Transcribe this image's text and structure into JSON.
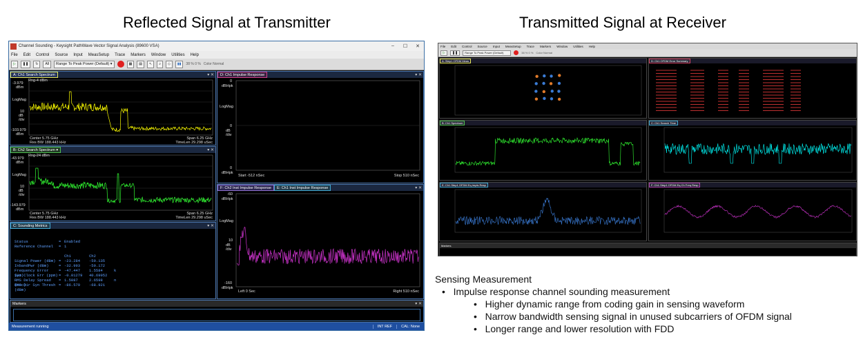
{
  "headline": {
    "left": "Reflected Signal at Transmitter",
    "right": "Transmitted Signal at Receiver"
  },
  "left_window": {
    "title": "Channel Sounding - Keysight PathWave Vector Signal Analysis (89600 VSA)",
    "controls": [
      "–",
      "☐",
      "✕"
    ],
    "menu": [
      "File",
      "Edit",
      "Control",
      "Source",
      "Input",
      "MeasSetup",
      "Trace",
      "Markers",
      "Window",
      "Utilities",
      "Help"
    ],
    "toolbar": {
      "all_label": "All",
      "range_dropdown": "Range To Peak Power (Default)",
      "progress": "38 %   0 %",
      "color_normal": "Color Normal"
    },
    "pane_a": {
      "tab": "A: Ch1 Search Spectrum",
      "top_value": "-3.979",
      "unit": "dBm",
      "scale_label": "LogMag",
      "div": "10",
      "div_unit": "dB /div",
      "bottom_value": "-103.979",
      "bottom_unit": "dBm",
      "rng": "Rng-4 dBm",
      "center": "Center 5.75 GHz",
      "res_bw": "Res BW 188.443 kHz",
      "span": "Span 6.25 GHz",
      "timelen": "TimeLen 29.298 uSec"
    },
    "pane_b": {
      "tab": "B: Ch2 Search Spectrum",
      "top_value": "-43.979",
      "unit": "dBm",
      "scale_label": "LogMag",
      "div": "10",
      "div_unit": "dB /div",
      "bottom_value": "-143.979",
      "bottom_unit": "dBm",
      "rng": "Rng-24 dBm",
      "center": "Center 5.75 GHz",
      "res_bw": "Res BW 188.443 kHz",
      "span": "Span 6.25 GHz",
      "timelen": "TimeLen 29.298 uSec"
    },
    "pane_c": {
      "tab": "C: Sounding Metrics",
      "status_label": "Status",
      "status_value": "Enabled",
      "ref_label": "Reference Channel",
      "ref_value": "1",
      "col_ch1": "Ch1",
      "col_ch2": "Ch2",
      "rows": [
        {
          "label": "Signal Power (dBm)",
          "ch1": "-23.284",
          "ch2": "-59.135",
          "unit": ""
        },
        {
          "label": "InbandPwr (dBm)",
          "ch1": "-32.993",
          "ch2": "-59.172",
          "unit": ""
        },
        {
          "label": "Frequency Error (Hz)",
          "ch1": "-47.447",
          "ch2": "1.5584",
          "unit": "k"
        },
        {
          "label": "Sym Clock Err (ppm)",
          "ch1": "-0.01279",
          "ch2": "40.69952",
          "unit": ""
        },
        {
          "label": "RMS Delay Spread (sec)",
          "ch1": "1.5087",
          "ch2": "2.6598",
          "unit": "n"
        },
        {
          "label": "RMS Dir Syn Thresh (dBm)",
          "ch1": "-86.579",
          "ch2": "-68.921",
          "unit": ""
        }
      ]
    },
    "pane_d": {
      "tab": "D: Ch1 Impulse Response",
      "top_value": "0",
      "unit": "dBHpk",
      "scale_label": "LogMag",
      "mid_value": "0",
      "mid_unit": "dB /div",
      "bottom_value": "0",
      "bottom_unit": "dBHpk",
      "start": "Start -512 nSec",
      "stop": "Stop 510 nSec"
    },
    "pane_ef": {
      "tab_f": "F: Ch2 Inst Impulse Response",
      "tab_e": "E: Ch1 Inst Impulse Response",
      "top_value": "-60",
      "unit": "dBHpk",
      "scale_label": "LogMag",
      "div": "10",
      "div_unit": "dB /div",
      "bottom_value": "-160",
      "bottom_unit": "dBHpk",
      "left": "Left 0 Sec",
      "right": "Right 510 nSec"
    },
    "markers_tab": "Markers",
    "status": "Measurement running",
    "status_right": [
      "INT REF",
      "CAL: None"
    ]
  },
  "right_window": {
    "panes": [
      {
        "tab": "A: Step1 OFDM Meas"
      },
      {
        "tab": "D: Ch1 OFDM Error Summary"
      },
      {
        "tab": "B: Ch1 Spectrum"
      },
      {
        "tab": "C: Ch1 Search Time"
      },
      {
        "tab": "E: Ch1 Step1 OFDM Eq Impls Resp"
      },
      {
        "tab": "F: Ch1 Step1 OFDM Eq Ch Freq Resp"
      }
    ],
    "markers_tab": "Markers"
  },
  "notes": {
    "heading": "Sensing Measurement",
    "bullet": "Impulse response channel sounding measurement",
    "sub_bullets": [
      "Higher dynamic range from coding gain in sensing waveform",
      "Narrow bandwidth sensing signal in unused subcarriers of OFDM signal",
      "Longer range and lower resolution with FDD"
    ]
  },
  "colors": {
    "trace_yellow": "#ffff00",
    "trace_green": "#33ff33",
    "trace_magenta": "#cc33cc",
    "trace_cyan": "#00ffff",
    "trace_blue": "#3a7bd5",
    "metrics_blue": "#5fa0ff",
    "status_blue": "#1f4fa0"
  }
}
